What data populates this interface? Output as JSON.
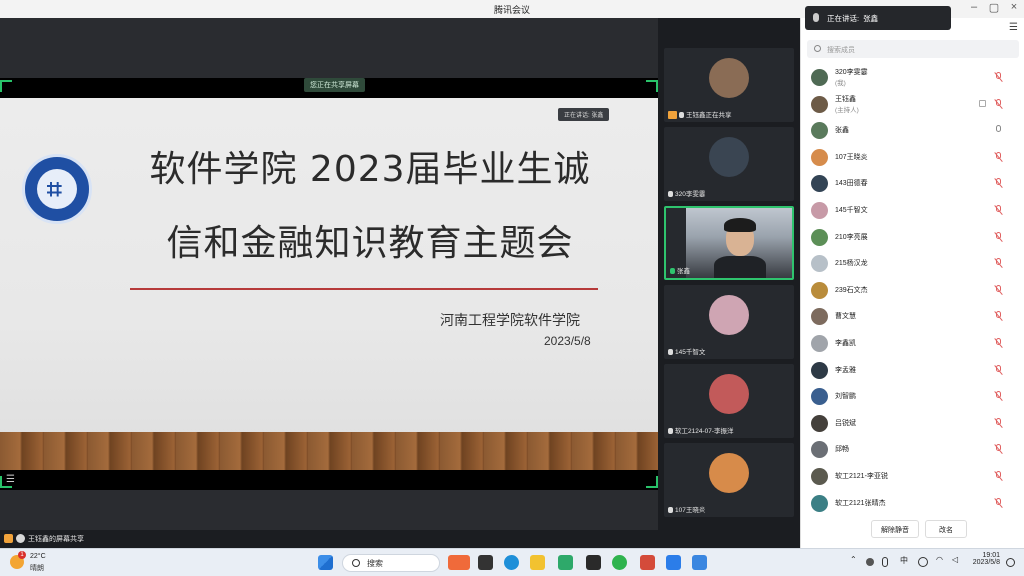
{
  "window": {
    "title": "腾讯会议"
  },
  "share": {
    "top_label": "您正在共享屏幕",
    "slide": {
      "title_line1": "软件学院 2023届毕业生诚",
      "title_line2": "信和金融知识教育主题会",
      "org": "河南工程学院软件学院",
      "date": "2023/5/8"
    },
    "inner_speaking": "正在讲话: 张鑫",
    "sharer_status": "王钰鑫的屏幕共享"
  },
  "videos": [
    {
      "name": "王钰鑫正在共享",
      "avatar": "bear",
      "color": "#8a6c55",
      "host": true
    },
    {
      "name": "320李雯霎",
      "avatar": "cat",
      "color": "#3a4552"
    },
    {
      "name": "张鑫",
      "avatar": "camera",
      "active": true
    },
    {
      "name": "145千智文",
      "avatar": "anime",
      "color": "#cfa5b3"
    },
    {
      "name": "软工2124-07-李振洋",
      "avatar": "girl",
      "color": "#c25a5a"
    },
    {
      "name": "107王晓炎",
      "avatar": "sunset",
      "color": "#d78b4a"
    }
  ],
  "panel": {
    "speaking_label": "正在讲话:",
    "speaking_name": "张鑫",
    "search_placeholder": "搜索成员",
    "participants": [
      {
        "name": "320李雯霎",
        "sub": "(我)",
        "color": "#4f6a54",
        "mic": "muted"
      },
      {
        "name": "王钰鑫",
        "sub": "(主持人)",
        "color": "#6d5b47",
        "mic": "muted",
        "extra": true
      },
      {
        "name": "张鑫",
        "color": "#5a7a5c",
        "mic": "on"
      },
      {
        "name": "107王晓炎",
        "color": "#d68c4c",
        "mic": "muted"
      },
      {
        "name": "143田德春",
        "color": "#334455",
        "mic": "muted"
      },
      {
        "name": "145千智文",
        "color": "#c79aa7",
        "mic": "muted"
      },
      {
        "name": "210李亮展",
        "color": "#5c8f57",
        "mic": "muted"
      },
      {
        "name": "215杨汉龙",
        "color": "#b7c0c8",
        "mic": "muted"
      },
      {
        "name": "239石文杰",
        "color": "#b98c3b",
        "mic": "muted"
      },
      {
        "name": "曹文慧",
        "color": "#7d6b5e",
        "mic": "muted"
      },
      {
        "name": "李鑫凯",
        "color": "#a0a4aa",
        "mic": "muted"
      },
      {
        "name": "李孟雅",
        "color": "#2e3a46",
        "mic": "muted"
      },
      {
        "name": "刘智鹏",
        "color": "#3a5f8f",
        "mic": "muted"
      },
      {
        "name": "吕锐斌",
        "color": "#44403b",
        "mic": "muted"
      },
      {
        "name": "邱畅",
        "color": "#6b6f75",
        "mic": "muted"
      },
      {
        "name": "软工2121-李亚锐",
        "color": "#5b5a4f",
        "mic": "muted"
      },
      {
        "name": "软工2121张晴杰",
        "color": "#3b7f85",
        "mic": "muted"
      }
    ],
    "unmute_all": "解除静音",
    "rename": "改名"
  },
  "taskbar": {
    "weather_temp": "22°C",
    "weather_cond": "晴朗",
    "weather_badge": "1",
    "search_label": "搜索",
    "ime": "中",
    "time": "19:01",
    "date": "2023/5/8"
  }
}
